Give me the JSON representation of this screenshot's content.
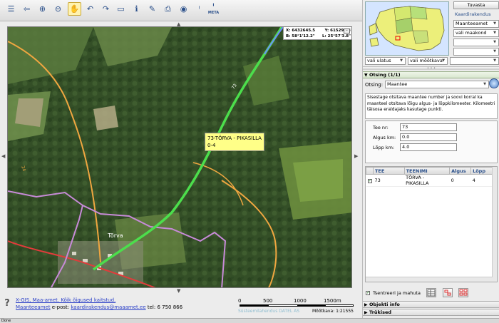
{
  "toolbar": {
    "tools": [
      {
        "name": "layers-icon",
        "glyph": "☰"
      },
      {
        "name": "pan-back-icon",
        "glyph": "⇦"
      },
      {
        "name": "zoom-in-icon",
        "glyph": "⊕"
      },
      {
        "name": "zoom-out-icon",
        "glyph": "⊖"
      },
      {
        "name": "hand-pan-icon",
        "glyph": "✋"
      },
      {
        "name": "undo-icon",
        "glyph": "↶"
      },
      {
        "name": "redo-icon",
        "glyph": "↷"
      },
      {
        "name": "measure-icon",
        "glyph": "▭"
      },
      {
        "name": "info-icon",
        "glyph": "ℹ"
      },
      {
        "name": "note-icon",
        "glyph": "✎"
      },
      {
        "name": "print-icon",
        "glyph": "⎙"
      },
      {
        "name": "camera-icon",
        "glyph": "◉"
      },
      {
        "name": "identify-icon",
        "glyph": "ⁱ"
      },
      {
        "name": "meta-icon",
        "glyph": "ⁱ",
        "label": "META"
      }
    ]
  },
  "map": {
    "coords": {
      "x": "X: 6432645.5",
      "y": "Y: 615296.3",
      "b": "B: 58°1'12.2\"",
      "l": "L: 25°57'3.8\""
    },
    "road_label_line1": "73-TÕRVA - PIKASILLA",
    "road_label_line2": "0-4",
    "town_label": "Tõrva",
    "road_numbers": [
      "73",
      "24"
    ]
  },
  "footer": {
    "line1": "X-GIS, Maa-amet. Kõik õigused kaitstud.",
    "line2_link": "Maanteeamet",
    "line2_text": " e-post: ",
    "email": "kaardirakendus@maaamet.ee",
    "phone": " tel: 6 750 866",
    "help_glyph": "?",
    "datel": "Süsteemilahendus DATEL AS",
    "scale_ticks": [
      "0",
      "500",
      "1000",
      "1500m"
    ],
    "mootkava": "Mõõtkava: 1:21555"
  },
  "status": {
    "text": "Done"
  },
  "right": {
    "button_tuvasta": "Tuvasta",
    "kaardirakendus": "Kaardirakendus",
    "select_app": "Maanteeamet",
    "select_county": "vali maakond",
    "vali_ulatus": "vali ulatus",
    "vali_mootkava": "vali mõõtkava",
    "otsing_header": "Otsing (1/1)",
    "otsing_label": "Otsing:",
    "otsing_value": "Maantee",
    "instructions": "Sisestage otsitava maantee number ja soovi korral ka maanteel otsitava lõigu algus- ja lõppkilomeeter. Kilomeetri täisosa eraldajaks kasutage punkti.",
    "fields": [
      {
        "label": "Tee nr:",
        "value": "73"
      },
      {
        "label": "Algus km:",
        "value": "0.0"
      },
      {
        "label": "Lõpp km:",
        "value": "4.0"
      }
    ],
    "table": {
      "headers": [
        "TEE",
        "TEENIMI",
        "Algus",
        "Lõpp"
      ],
      "rows": [
        {
          "tee": "73",
          "teenimi": "TÕRVA - PIKASILLA",
          "algus": "0",
          "lopp": "4"
        }
      ]
    },
    "tsentreeri": "Tsentreeri ja mahuta",
    "objekti_info": "Objekti info",
    "trukised": "Trükised"
  }
}
